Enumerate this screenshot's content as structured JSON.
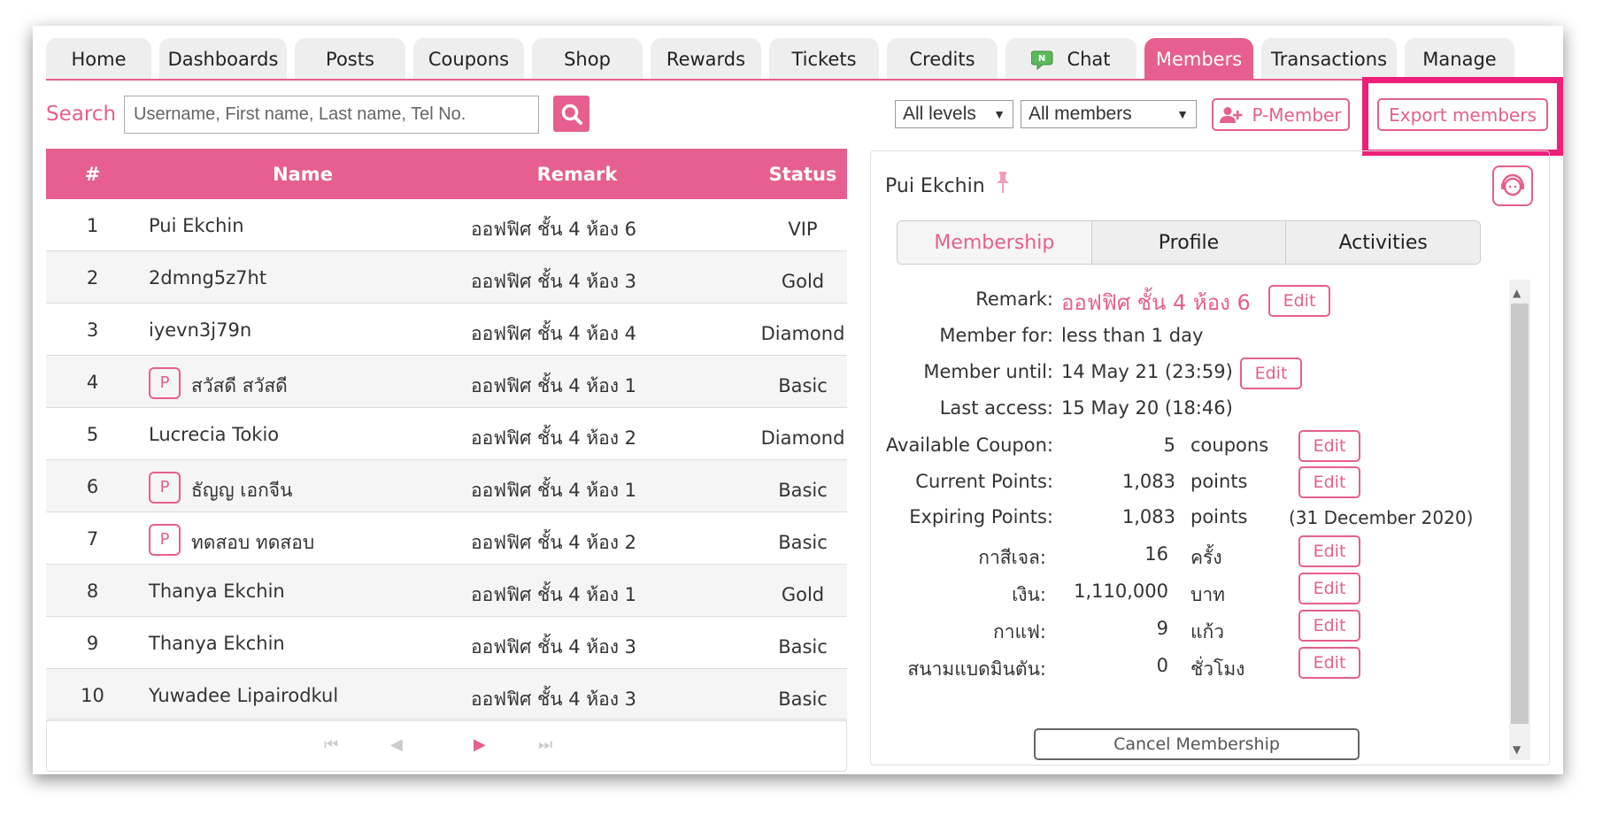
{
  "tabs": [
    {
      "label": "Home"
    },
    {
      "label": "Dashboards"
    },
    {
      "label": "Posts"
    },
    {
      "label": "Coupons"
    },
    {
      "label": "Shop"
    },
    {
      "label": "Rewards"
    },
    {
      "label": "Tickets"
    },
    {
      "label": "Credits"
    },
    {
      "label": "Chat"
    },
    {
      "label": "Members"
    },
    {
      "label": "Transactions"
    },
    {
      "label": "Manage"
    }
  ],
  "active_tab": "Members",
  "search": {
    "label": "Search",
    "placeholder": "Username, First name, Last name, Tel No."
  },
  "filters": {
    "level": "All levels",
    "members": "All members"
  },
  "buttons": {
    "p_member": "P-Member",
    "export": "Export members"
  },
  "table": {
    "headers": [
      "#",
      "Name",
      "Remark",
      "Status"
    ],
    "rows": [
      {
        "num": "1",
        "name": "Pui Ekchin",
        "p": false,
        "remark": "ออฟฟิศ ชั้น 4 ห้อง 6",
        "status": "VIP"
      },
      {
        "num": "2",
        "name": "2dmng5z7ht",
        "p": false,
        "remark": "ออฟฟิศ ชั้น 4 ห้อง 3",
        "status": "Gold"
      },
      {
        "num": "3",
        "name": "iyevn3j79n",
        "p": false,
        "remark": "ออฟฟิศ ชั้น 4 ห้อง 4",
        "status": "Diamond"
      },
      {
        "num": "4",
        "name": "สวัสดี สวัสดี",
        "p": true,
        "remark": "ออฟฟิศ ชั้น 4 ห้อง 1",
        "status": "Basic"
      },
      {
        "num": "5",
        "name": "Lucrecia Tokio",
        "p": false,
        "remark": "ออฟฟิศ ชั้น 4 ห้อง 2",
        "status": "Diamond"
      },
      {
        "num": "6",
        "name": "ธัญญ เอกจีน",
        "p": true,
        "remark": "ออฟฟิศ ชั้น 4 ห้อง 1",
        "status": "Basic"
      },
      {
        "num": "7",
        "name": "ทดสอบ ทดสอบ",
        "p": true,
        "remark": "ออฟฟิศ ชั้น 4 ห้อง 2",
        "status": "Basic"
      },
      {
        "num": "8",
        "name": "Thanya Ekchin",
        "p": false,
        "remark": "ออฟฟิศ ชั้น 4 ห้อง 1",
        "status": "Gold"
      },
      {
        "num": "9",
        "name": "Thanya Ekchin",
        "p": false,
        "remark": "ออฟฟิศ ชั้น 4 ห้อง 3",
        "status": "Basic"
      },
      {
        "num": "10",
        "name": "Yuwadee Lipairodkul",
        "p": false,
        "remark": "ออฟฟิศ ชั้น 4 ห้อง 3",
        "status": "Basic"
      }
    ],
    "p_badge": "P"
  },
  "pager": {
    "first": "⏮",
    "prev": "◀",
    "next": "▶",
    "last": "⏭"
  },
  "detail": {
    "name": "Pui Ekchin",
    "subtabs": [
      "Membership",
      "Profile",
      "Activities"
    ],
    "remark_label": "Remark:",
    "remark_value": "ออฟฟิศ ชั้น 4 ห้อง 6",
    "member_for_label": "Member for:",
    "member_for_value": "less than 1 day",
    "member_until_label": "Member until:",
    "member_until_value": "14 May 21 (23:59)",
    "last_access_label": "Last access:",
    "last_access_value": "15 May 20 (18:46)",
    "coupon_label": "Available Coupon:",
    "coupon_value": "5",
    "coupon_unit": "coupons",
    "points_label": "Current Points:",
    "points_value": "1,083",
    "points_unit": "points",
    "expiring_label": "Expiring Points:",
    "expiring_value": "1,083",
    "expiring_unit": "points",
    "expiring_date": "(31 December 2020)",
    "credits": [
      {
        "label": "กาสีเจล:",
        "value": "16",
        "unit": "ครั้ง"
      },
      {
        "label": "เงิน:",
        "value": "1,110,000",
        "unit": "บาท"
      },
      {
        "label": "กาแฟ:",
        "value": "9",
        "unit": "แก้ว"
      },
      {
        "label": "สนามแบดมินตัน:",
        "value": "0",
        "unit": "ชั่วโมง"
      }
    ],
    "edit_label": "Edit",
    "cancel_label": "Cancel Membership"
  },
  "colors": {
    "accent": "#e65f8e",
    "highlight": "#ee1f78"
  }
}
